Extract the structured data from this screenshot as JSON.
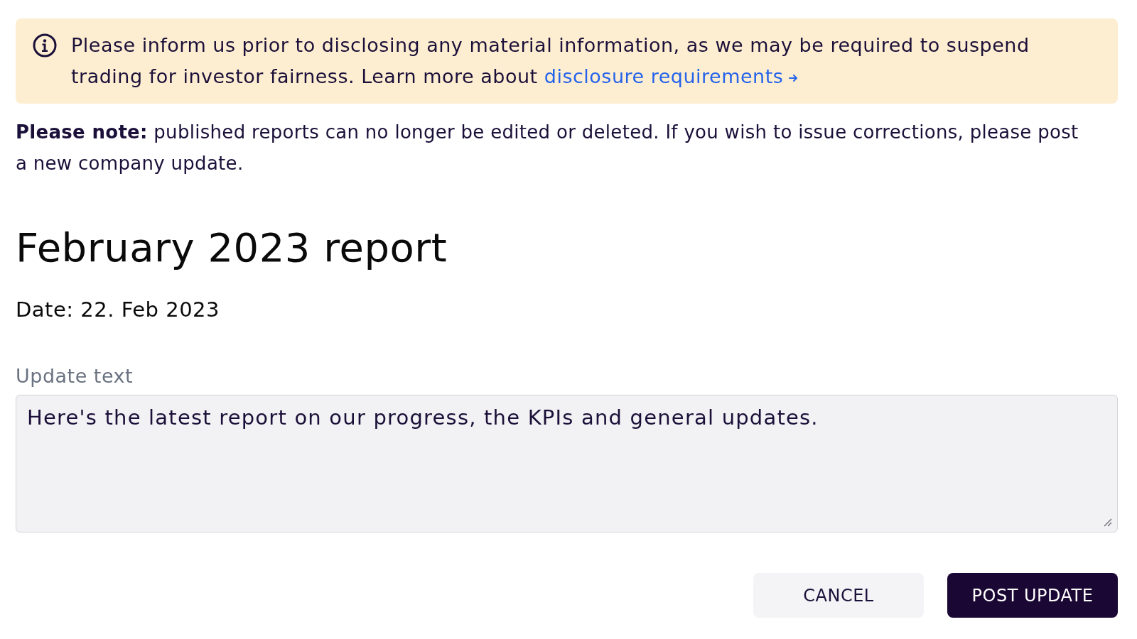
{
  "notice": {
    "text": "Please inform us prior to disclosing any material information, as we may be required to suspend trading for investor fairness. Learn more about",
    "link": "disclosure requirements"
  },
  "note": "**Please note:** published reports can no longer be edited or deleted. If you wish to issue corrections, please post a new company update.",
  "report": {
    "title": "February 2023 report",
    "date": "Date: 22. Feb 2023"
  },
  "update_text": {
    "label": "Update text",
    "value": "Here's the latest report on our progress, the KPIs and general updates."
  },
  "buttons": [
    {
      "label": "CANCEL",
      "kind": "secondary"
    },
    {
      "label": "POST UPDATE",
      "kind": "primary"
    }
  ]
}
